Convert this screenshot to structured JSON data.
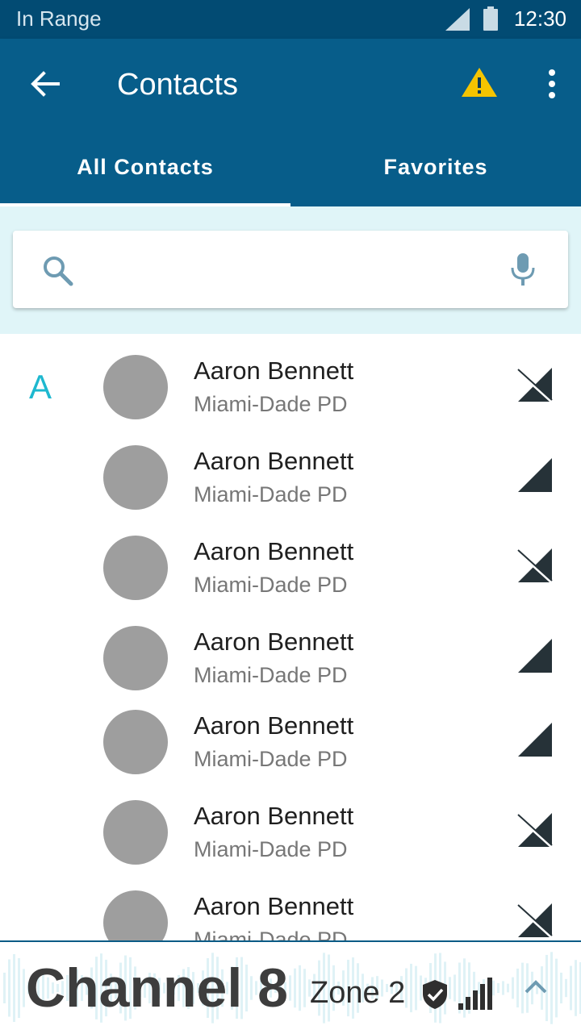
{
  "status_bar": {
    "left_text": "In Range",
    "time": "12:30"
  },
  "app_bar": {
    "title": "Contacts"
  },
  "tabs": [
    {
      "label": "All Contacts",
      "active": true
    },
    {
      "label": "Favorites",
      "active": false
    }
  ],
  "search": {
    "value": "",
    "placeholder": ""
  },
  "section_letter": "A",
  "contacts": [
    {
      "name": "Aaron Bennett",
      "org": "Miami-Dade PD",
      "status": "no-signal"
    },
    {
      "name": "Aaron Bennett",
      "org": "Miami-Dade PD",
      "status": "signal"
    },
    {
      "name": "Aaron Bennett",
      "org": "Miami-Dade PD",
      "status": "no-signal"
    },
    {
      "name": "Aaron Bennett",
      "org": "Miami-Dade PD",
      "status": "signal"
    },
    {
      "name": "Aaron Bennett",
      "org": "Miami-Dade PD",
      "status": "signal"
    },
    {
      "name": "Aaron Bennett",
      "org": "Miami-Dade PD",
      "status": "no-signal"
    },
    {
      "name": "Aaron Bennett",
      "org": "Miami-Dade PD",
      "status": "no-signal"
    }
  ],
  "bottom_bar": {
    "channel": "Channel 8",
    "zone": "Zone 2"
  },
  "colors": {
    "status_bar": "#024b73",
    "app_bar": "#075d8a",
    "search_area": "#e0f5f8",
    "accent_letter": "#1eb8cf",
    "warning": "#f5c400",
    "avatar": "#9e9e9e"
  },
  "icons": [
    "back-arrow-icon",
    "warning-icon",
    "more-vert-icon",
    "search-icon",
    "mic-icon",
    "signal-icon",
    "no-signal-icon",
    "shield-check-icon",
    "signal-bars-icon",
    "chevron-up-icon"
  ]
}
